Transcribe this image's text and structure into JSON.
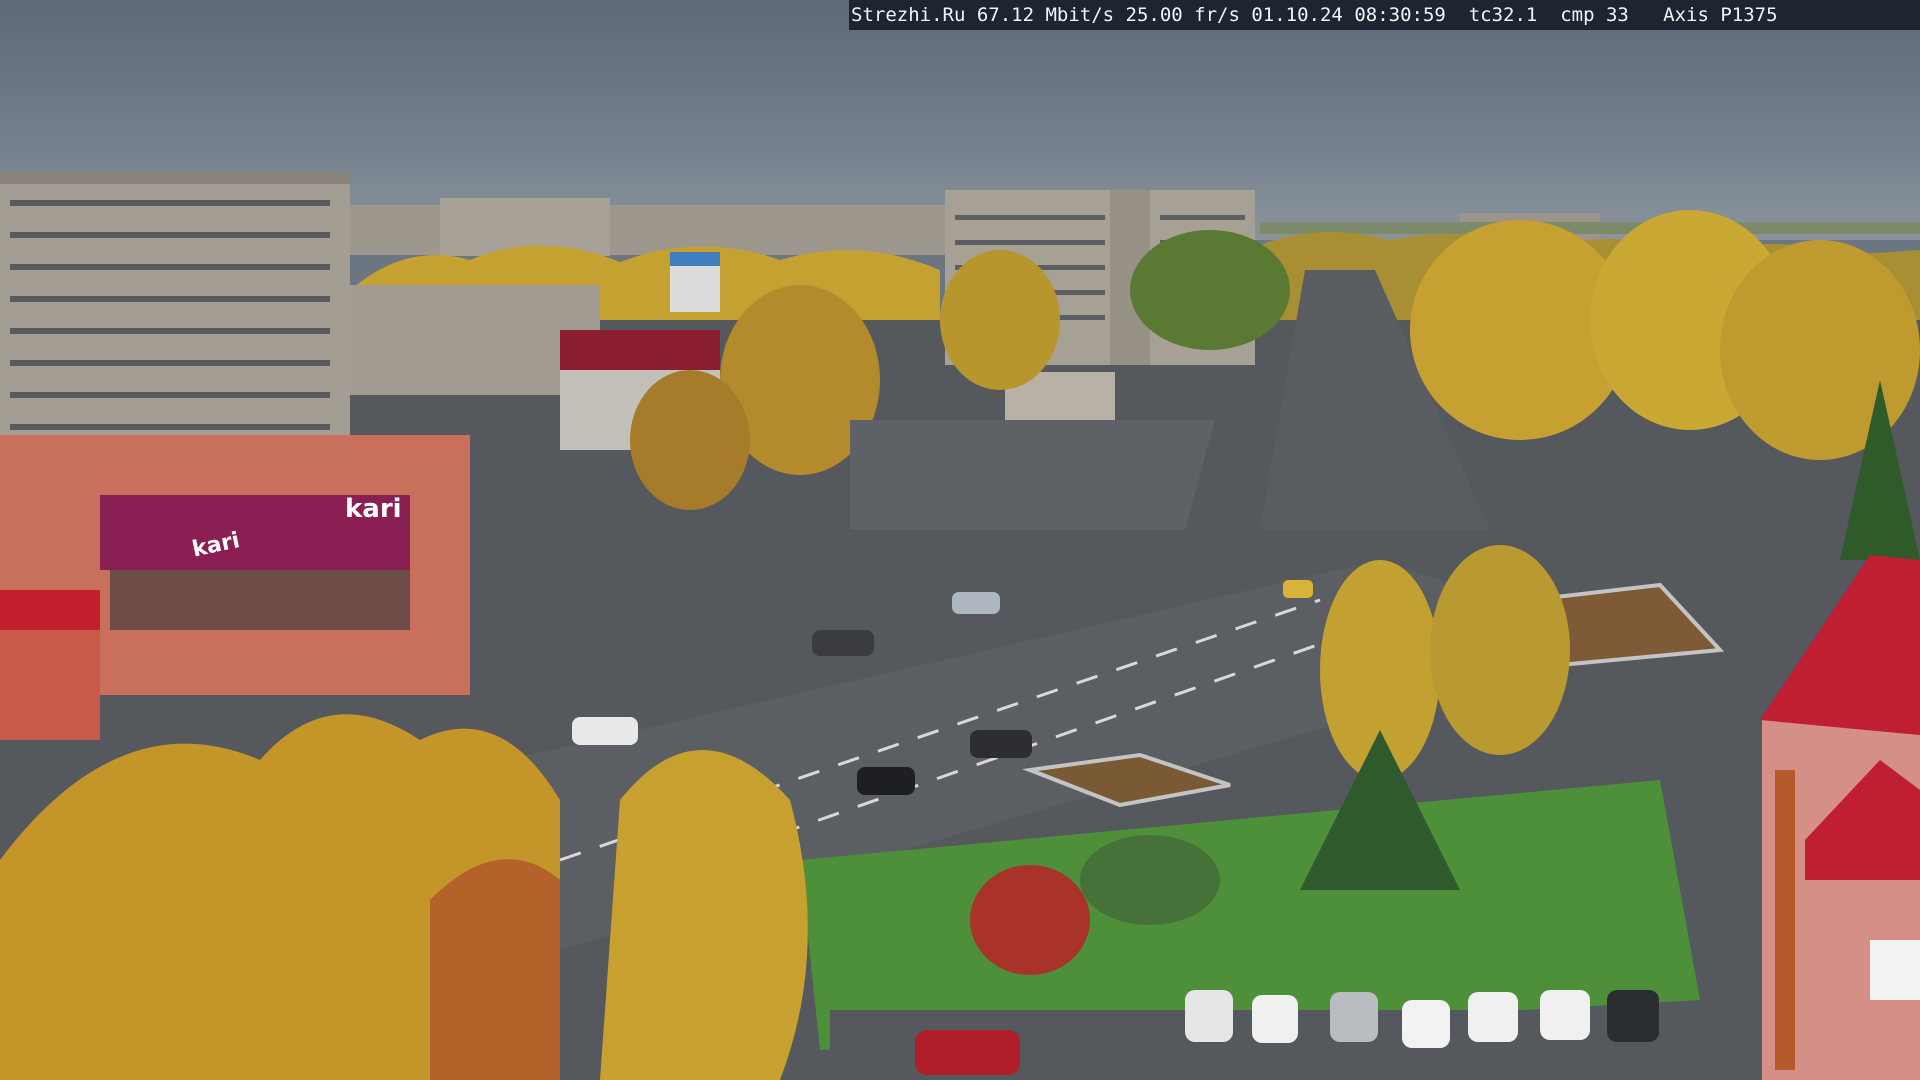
{
  "camera": {
    "overlay_text": "Strezhi.Ru 67.12 Mbit/s 25.00 fr/s 01.10.24 08:30:59  tc32.1  cmp 33   Axis P1375"
  },
  "scene": {
    "store_sign": "kari",
    "store_sign_secondary": "kari"
  },
  "colors": {
    "sky": "#6c7a8c",
    "foliage": "#c9a530",
    "road": "#5a5d62",
    "grass": "#4e8f3a",
    "store_facade": "#8a1f54",
    "roof_red": "#b51e2b"
  }
}
